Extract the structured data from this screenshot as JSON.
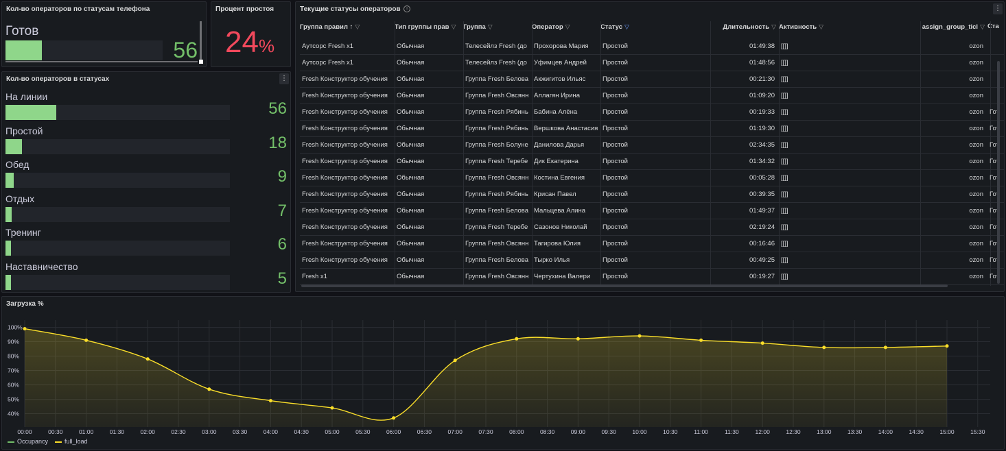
{
  "phone_panel": {
    "title": "Кол-во операторов по статусам телефона",
    "label": "Готов",
    "value": "56",
    "fraction": 0.23
  },
  "idle_panel": {
    "title": "Процент простоя",
    "value": "24",
    "unit": "%"
  },
  "status_panel": {
    "title": "Кол-во операторов в статусах",
    "max": 56,
    "rows": [
      {
        "label": "На линии",
        "value": 56
      },
      {
        "label": "Простой",
        "value": 18
      },
      {
        "label": "Обед",
        "value": 9
      },
      {
        "label": "Отдых",
        "value": 7
      },
      {
        "label": "Тренинг",
        "value": 6
      },
      {
        "label": "Наставничество",
        "value": 5
      }
    ]
  },
  "table_panel": {
    "title": "Текущие статусы операторов",
    "columns": [
      "Группа правил",
      "Тип группы прав",
      "Группа",
      "Оператор",
      "Статус",
      "Длительность",
      "Активность",
      "assign_group_ticl",
      "Ста"
    ],
    "sort_arrow": "↑",
    "rows": [
      [
        "Аутсорс Fresh x1",
        "Обычная",
        "Телесейлз Fresh (до",
        "Прохорова Мария",
        "Простой",
        "01:49:38",
        "[[]]",
        "ozon",
        ""
      ],
      [
        "Аутсорс Fresh x1",
        "Обычная",
        "Телесейлз Fresh (до",
        "Уфимцев Андрей",
        "Простой",
        "01:48:56",
        "[[]]",
        "ozon",
        ""
      ],
      [
        "Fresh Конструктор обучения",
        "Обычная",
        "Группа Fresh Белова",
        "Акжигитов Ильяс",
        "Простой",
        "00:21:30",
        "[[]]",
        "ozon",
        ""
      ],
      [
        "Fresh Конструктор обучения",
        "Обычная",
        "Группа Fresh Овсянн",
        "Аллагян Ирина",
        "Простой",
        "01:09:20",
        "[[]]",
        "ozon",
        ""
      ],
      [
        "Fresh Конструктор обучения",
        "Обычная",
        "Группа Fresh Рябинь",
        "Бабина Алёна",
        "Простой",
        "00:19:33",
        "[[]]",
        "ozon",
        "Гот"
      ],
      [
        "Fresh Конструктор обучения",
        "Обычная",
        "Группа Fresh Рябинь",
        "Вершкова Анастасия",
        "Простой",
        "01:19:30",
        "[[]]",
        "ozon",
        "Гот"
      ],
      [
        "Fresh Конструктор обучения",
        "Обычная",
        "Группа Fresh Болуне",
        "Данилова Дарья",
        "Простой",
        "02:34:35",
        "[[]]",
        "ozon",
        "Гот"
      ],
      [
        "Fresh Конструктор обучения",
        "Обычная",
        "Группа Fresh Теребе",
        "Дик Екатерина",
        "Простой",
        "01:34:32",
        "[[]]",
        "ozon",
        "Гот"
      ],
      [
        "Fresh Конструктор обучения",
        "Обычная",
        "Группа Fresh Овсянн",
        "Костина Евгения",
        "Простой",
        "00:05:28",
        "[[]]",
        "ozon",
        "Гот"
      ],
      [
        "Fresh Конструктор обучения",
        "Обычная",
        "Группа Fresh Рябинь",
        "Крисан Павел",
        "Простой",
        "00:39:35",
        "[[]]",
        "ozon",
        "Гот"
      ],
      [
        "Fresh Конструктор обучения",
        "Обычная",
        "Группа Fresh Белова",
        "Мальцева Алина",
        "Простой",
        "01:49:37",
        "[[]]",
        "ozon",
        "Гот"
      ],
      [
        "Fresh Конструктор обучения",
        "Обычная",
        "Группа Fresh Теребе",
        "Сазонов Николай",
        "Простой",
        "02:19:24",
        "[[]]",
        "ozon",
        "Гот"
      ],
      [
        "Fresh Конструктор обучения",
        "Обычная",
        "Группа Fresh Овсянн",
        "Тагирова Юлия",
        "Простой",
        "00:16:46",
        "[[]]",
        "ozon",
        "Гот"
      ],
      [
        "Fresh Конструктор обучения",
        "Обычная",
        "Группа Fresh Белова",
        "Тырко Илья",
        "Простой",
        "00:49:25",
        "[[]]",
        "ozon",
        "Гот"
      ],
      [
        "Fresh x1",
        "Обычная",
        "Группа Fresh Овсянн",
        "Чертухина Валери",
        "Простой",
        "00:19:27",
        "[[]]",
        "ozon",
        "Гот"
      ]
    ]
  },
  "chart_panel": {
    "title": "Загрузка %"
  },
  "chart_data": {
    "type": "line",
    "x": [
      "00:00",
      "01:00",
      "02:00",
      "03:00",
      "04:00",
      "05:00",
      "06:00",
      "07:00",
      "08:00",
      "09:00",
      "10:00",
      "11:00",
      "12:00",
      "13:00",
      "14:00",
      "15:00"
    ],
    "xticks": [
      "00:00",
      "00:30",
      "01:00",
      "01:30",
      "02:00",
      "02:30",
      "03:00",
      "03:30",
      "04:00",
      "04:30",
      "05:00",
      "05:30",
      "06:00",
      "06:30",
      "07:00",
      "07:30",
      "08:00",
      "08:30",
      "09:00",
      "09:30",
      "10:00",
      "10:30",
      "11:00",
      "11:30",
      "12:00",
      "12:30",
      "13:00",
      "13:30",
      "14:00",
      "14:30",
      "15:00",
      "15:30"
    ],
    "yticks": [
      "100%",
      "90%",
      "80%",
      "70%",
      "60%",
      "50%",
      "40%"
    ],
    "ylim": [
      35,
      100
    ],
    "series": [
      {
        "name": "Occupancy",
        "color": "#73bf69",
        "values": []
      },
      {
        "name": "full_load",
        "color": "#fade2a",
        "values": [
          99,
          91,
          78,
          57,
          49,
          44,
          37,
          77,
          92,
          92,
          94,
          91,
          89,
          86,
          86,
          87
        ]
      }
    ],
    "legend": "bottom-left",
    "grid": true
  }
}
